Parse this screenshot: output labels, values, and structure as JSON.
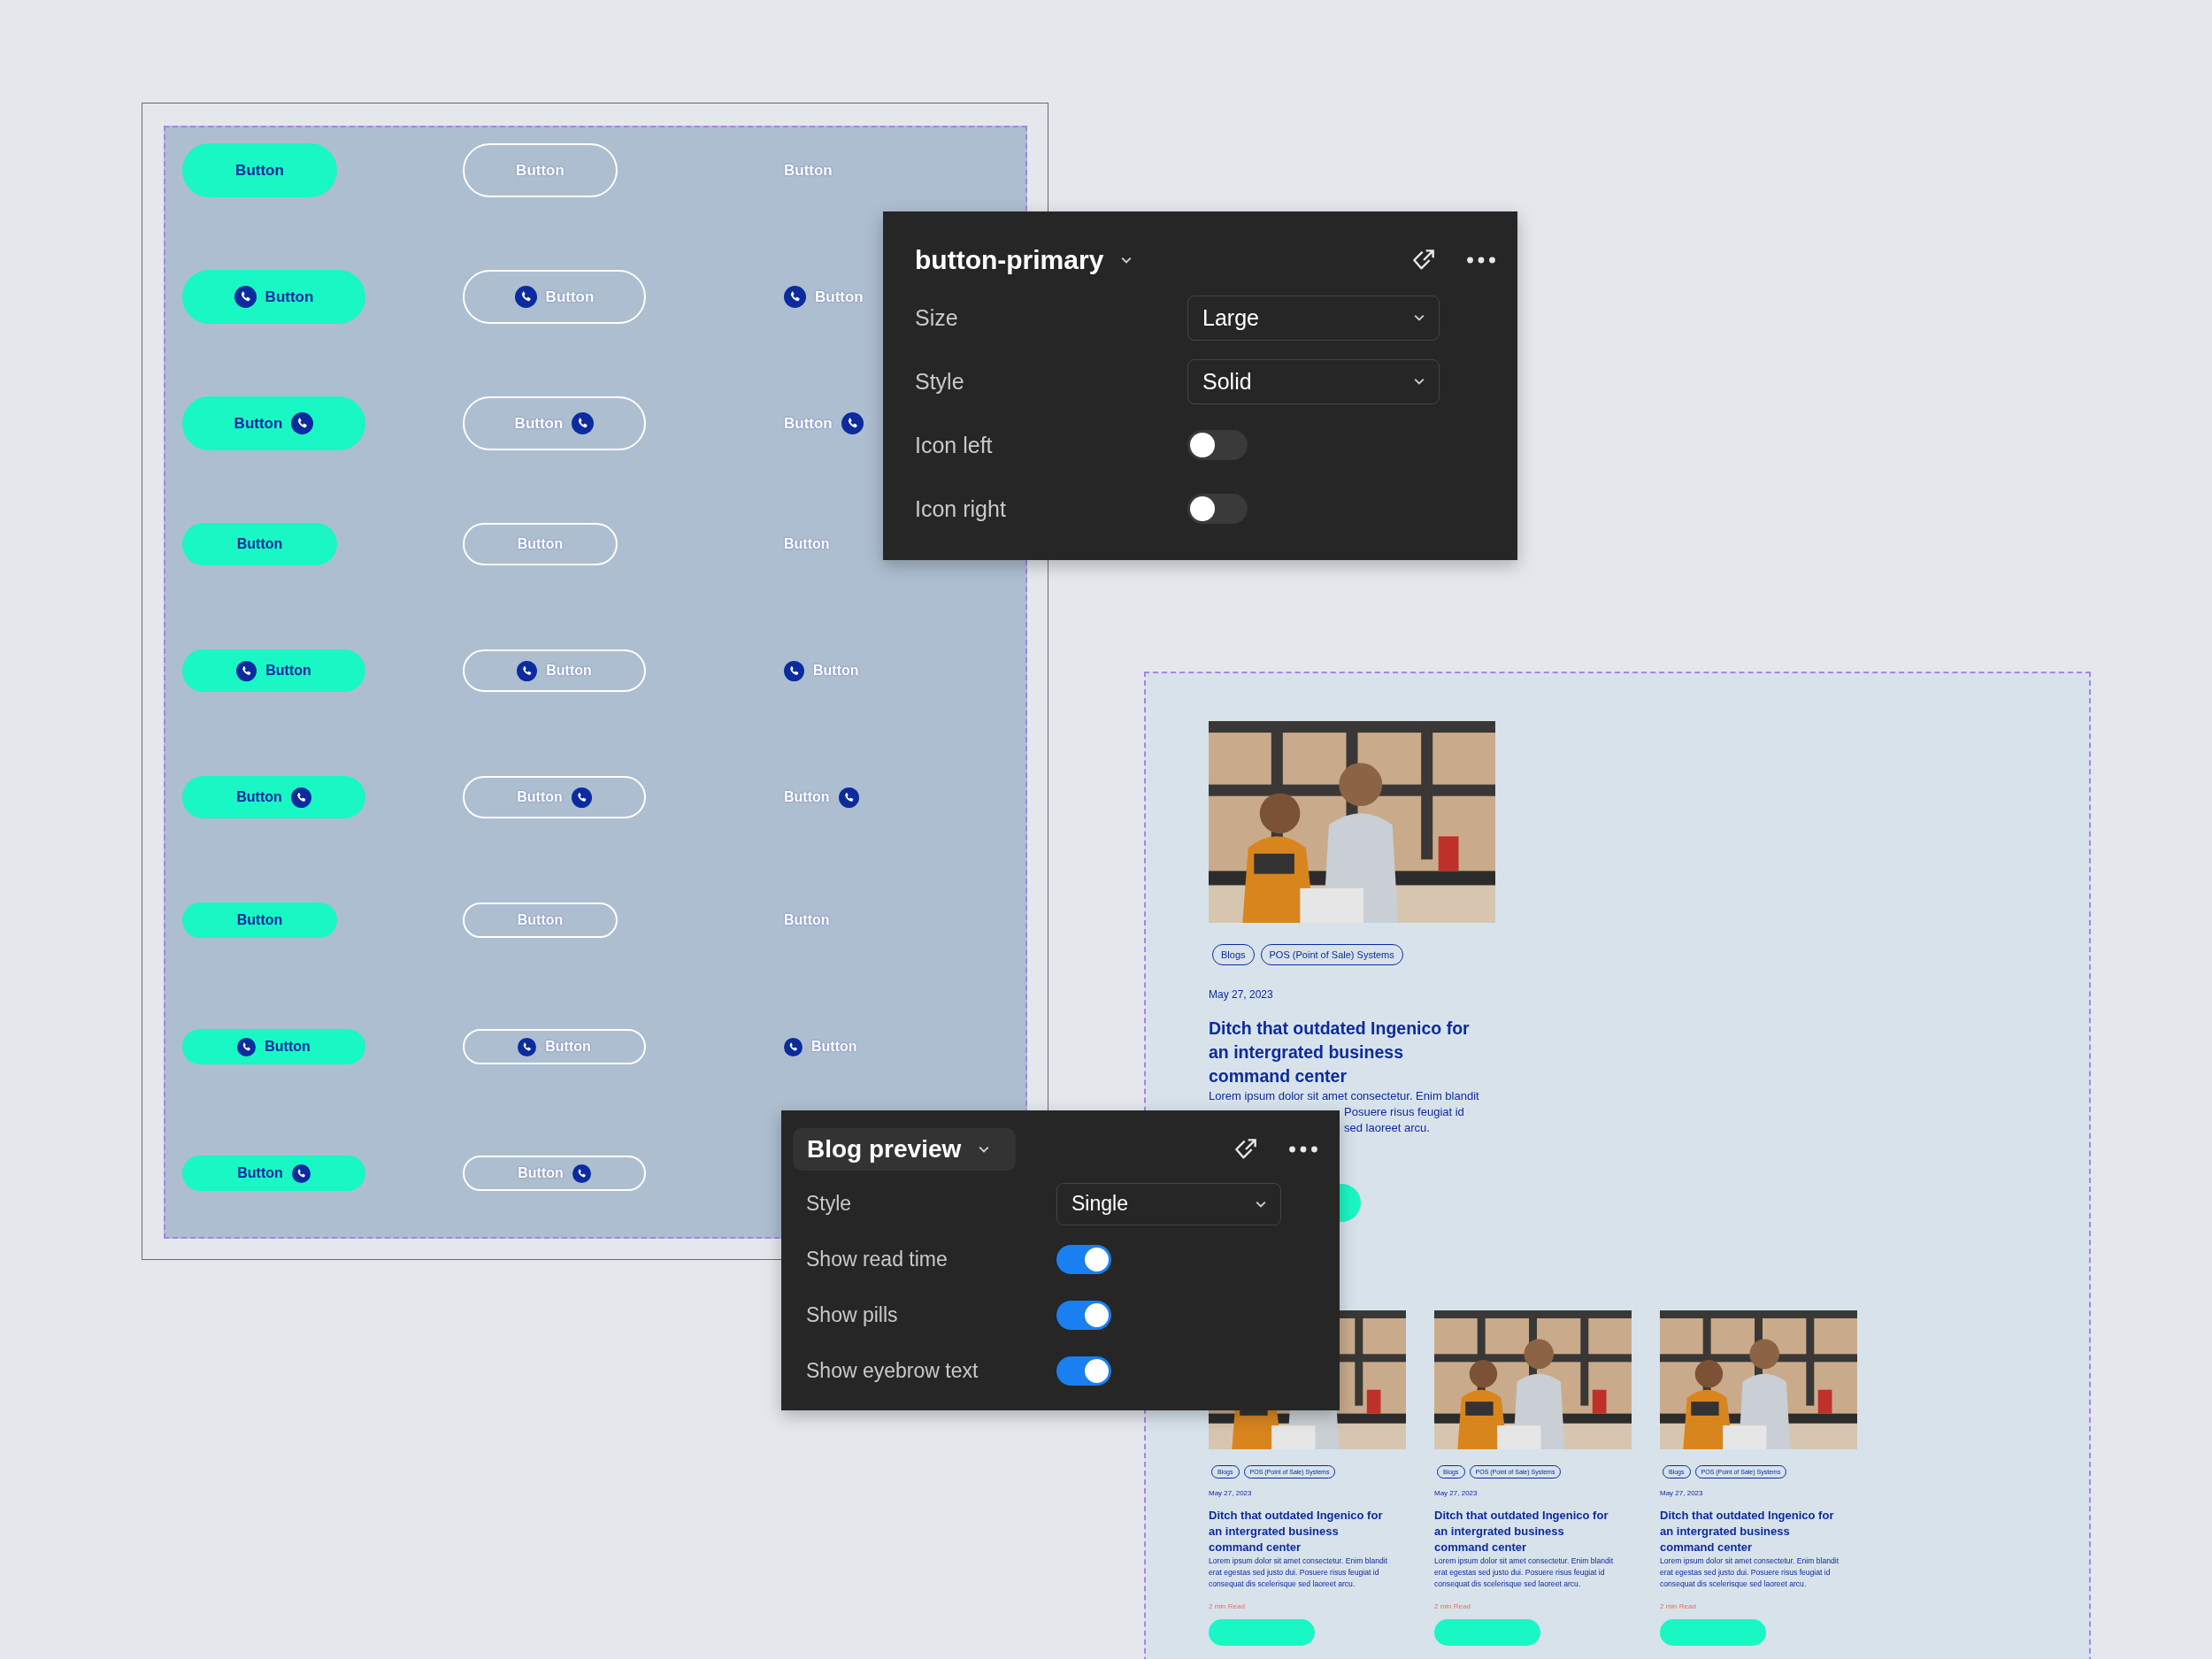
{
  "button_grid": {
    "rows": [
      {
        "kind": "plain",
        "buttons": [
          {
            "label": "Button"
          },
          {
            "label": "Button"
          },
          {
            "label": "Button"
          }
        ]
      },
      {
        "kind": "leading",
        "buttons": [
          {
            "label": "Button"
          },
          {
            "label": "Button"
          },
          {
            "label": "Button"
          }
        ]
      },
      {
        "kind": "trailing",
        "buttons": [
          {
            "label": "Button"
          },
          {
            "label": "Button"
          },
          {
            "label": "Button"
          }
        ]
      },
      {
        "kind": "plain",
        "buttons": [
          {
            "label": "Button"
          },
          {
            "label": "Button"
          },
          {
            "label": "Button"
          }
        ]
      },
      {
        "kind": "leading",
        "buttons": [
          {
            "label": "Button"
          },
          {
            "label": "Button"
          },
          {
            "label": "Button"
          }
        ]
      },
      {
        "kind": "trailing",
        "buttons": [
          {
            "label": "Button"
          },
          {
            "label": "Button"
          },
          {
            "label": "Button"
          }
        ]
      },
      {
        "kind": "plain",
        "buttons": [
          {
            "label": "Button"
          },
          {
            "label": "Button"
          },
          {
            "label": "Button"
          }
        ]
      },
      {
        "kind": "leading",
        "buttons": [
          {
            "label": "Button"
          },
          {
            "label": "Button"
          },
          {
            "label": "Button"
          }
        ]
      },
      {
        "kind": "trailing",
        "buttons": [
          {
            "label": "Button"
          },
          {
            "label": "Button"
          }
        ]
      }
    ]
  },
  "component_panel": {
    "title": "button-primary",
    "properties": [
      {
        "kind": "select",
        "label": "Size",
        "value": "Large"
      },
      {
        "kind": "select",
        "label": "Style",
        "value": "Solid"
      },
      {
        "kind": "toggle",
        "label": "Icon left",
        "on": false
      },
      {
        "kind": "toggle",
        "label": "Icon right",
        "on": false
      }
    ]
  },
  "blog_frame": {
    "posts": [
      {
        "kind": "featured",
        "pills": [
          "Blogs",
          "POS (Point of Sale) Systems"
        ],
        "date": "May 27, 2023",
        "title": "Ditch that outdated Ingenico for an intergrated business command center",
        "body_lines": [
          {
            "text": "Lorem ipsum dolor sit amet consectetur. Enim blandit",
            "covered_start": false
          },
          {
            "text": "Posuere risus feugiat id",
            "covered_start": true
          },
          {
            "text": "sed laoreet arcu.",
            "covered_start": true
          }
        ]
      },
      {
        "kind": "grid",
        "pills": [
          "Blogs",
          "POS (Point of Sale) Systems"
        ],
        "date": "May 27, 2023",
        "title": "Ditch that outdated Ingenico for an intergrated business command center",
        "body_lines": [
          {
            "text": "Lorem ipsum dolor sit amet consectetur. Enim blandit",
            "covered_start": false
          },
          {
            "text": "erat egestas sed justo dui. Posuere risus feugiat id",
            "covered_start": false
          },
          {
            "text": "consequat dis scelerisque sed laoreet arcu.",
            "covered_start": false
          }
        ],
        "read_time": "2 min Read"
      },
      {
        "kind": "grid",
        "pills": [
          "Blogs",
          "POS (Point of Sale) Systems"
        ],
        "date": "May 27, 2023",
        "title": "Ditch that outdated Ingenico for an intergrated business command center",
        "body_lines": [
          {
            "text": "Lorem ipsum dolor sit amet consectetur. Enim blandit",
            "covered_start": false
          },
          {
            "text": "erat egestas sed justo dui. Posuere risus feugiat id",
            "covered_start": false
          },
          {
            "text": "consequat dis scelerisque sed laoreet arcu.",
            "covered_start": false
          }
        ],
        "read_time": "2 min Read"
      },
      {
        "kind": "grid",
        "pills": [
          "Blogs",
          "POS (Point of Sale) Systems"
        ],
        "date": "May 27, 2023",
        "title": "Ditch that outdated Ingenico for an intergrated business command center",
        "body_lines": [
          {
            "text": "Lorem ipsum dolor sit amet consectetur. Enim blandit",
            "covered_start": false
          },
          {
            "text": "erat egestas sed justo dui. Posuere risus feugiat id",
            "covered_start": false
          },
          {
            "text": "consequat dis scelerisque sed laoreet arcu.",
            "covered_start": false
          }
        ],
        "read_time": "2 min Read"
      }
    ]
  },
  "blog_panel": {
    "title": "Blog preview",
    "properties": [
      {
        "kind": "select",
        "label": "Style",
        "value": "Single"
      },
      {
        "kind": "toggle",
        "label": "Show read time",
        "on": true
      },
      {
        "kind": "toggle",
        "label": "Show pills",
        "on": true
      },
      {
        "kind": "toggle",
        "label": "Show eyebrow text",
        "on": true
      }
    ]
  }
}
